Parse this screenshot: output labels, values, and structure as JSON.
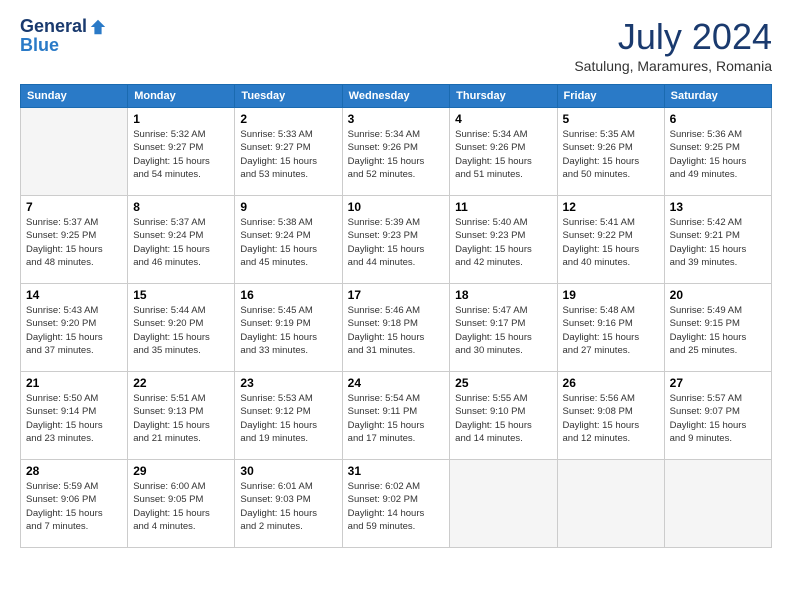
{
  "header": {
    "logo_general": "General",
    "logo_blue": "Blue",
    "month_year": "July 2024",
    "location": "Satulung, Maramures, Romania"
  },
  "days_of_week": [
    "Sunday",
    "Monday",
    "Tuesday",
    "Wednesday",
    "Thursday",
    "Friday",
    "Saturday"
  ],
  "weeks": [
    [
      {
        "day": "",
        "info": ""
      },
      {
        "day": "1",
        "info": "Sunrise: 5:32 AM\nSunset: 9:27 PM\nDaylight: 15 hours\nand 54 minutes."
      },
      {
        "day": "2",
        "info": "Sunrise: 5:33 AM\nSunset: 9:27 PM\nDaylight: 15 hours\nand 53 minutes."
      },
      {
        "day": "3",
        "info": "Sunrise: 5:34 AM\nSunset: 9:26 PM\nDaylight: 15 hours\nand 52 minutes."
      },
      {
        "day": "4",
        "info": "Sunrise: 5:34 AM\nSunset: 9:26 PM\nDaylight: 15 hours\nand 51 minutes."
      },
      {
        "day": "5",
        "info": "Sunrise: 5:35 AM\nSunset: 9:26 PM\nDaylight: 15 hours\nand 50 minutes."
      },
      {
        "day": "6",
        "info": "Sunrise: 5:36 AM\nSunset: 9:25 PM\nDaylight: 15 hours\nand 49 minutes."
      }
    ],
    [
      {
        "day": "7",
        "info": "Sunrise: 5:37 AM\nSunset: 9:25 PM\nDaylight: 15 hours\nand 48 minutes."
      },
      {
        "day": "8",
        "info": "Sunrise: 5:37 AM\nSunset: 9:24 PM\nDaylight: 15 hours\nand 46 minutes."
      },
      {
        "day": "9",
        "info": "Sunrise: 5:38 AM\nSunset: 9:24 PM\nDaylight: 15 hours\nand 45 minutes."
      },
      {
        "day": "10",
        "info": "Sunrise: 5:39 AM\nSunset: 9:23 PM\nDaylight: 15 hours\nand 44 minutes."
      },
      {
        "day": "11",
        "info": "Sunrise: 5:40 AM\nSunset: 9:23 PM\nDaylight: 15 hours\nand 42 minutes."
      },
      {
        "day": "12",
        "info": "Sunrise: 5:41 AM\nSunset: 9:22 PM\nDaylight: 15 hours\nand 40 minutes."
      },
      {
        "day": "13",
        "info": "Sunrise: 5:42 AM\nSunset: 9:21 PM\nDaylight: 15 hours\nand 39 minutes."
      }
    ],
    [
      {
        "day": "14",
        "info": "Sunrise: 5:43 AM\nSunset: 9:20 PM\nDaylight: 15 hours\nand 37 minutes."
      },
      {
        "day": "15",
        "info": "Sunrise: 5:44 AM\nSunset: 9:20 PM\nDaylight: 15 hours\nand 35 minutes."
      },
      {
        "day": "16",
        "info": "Sunrise: 5:45 AM\nSunset: 9:19 PM\nDaylight: 15 hours\nand 33 minutes."
      },
      {
        "day": "17",
        "info": "Sunrise: 5:46 AM\nSunset: 9:18 PM\nDaylight: 15 hours\nand 31 minutes."
      },
      {
        "day": "18",
        "info": "Sunrise: 5:47 AM\nSunset: 9:17 PM\nDaylight: 15 hours\nand 30 minutes."
      },
      {
        "day": "19",
        "info": "Sunrise: 5:48 AM\nSunset: 9:16 PM\nDaylight: 15 hours\nand 27 minutes."
      },
      {
        "day": "20",
        "info": "Sunrise: 5:49 AM\nSunset: 9:15 PM\nDaylight: 15 hours\nand 25 minutes."
      }
    ],
    [
      {
        "day": "21",
        "info": "Sunrise: 5:50 AM\nSunset: 9:14 PM\nDaylight: 15 hours\nand 23 minutes."
      },
      {
        "day": "22",
        "info": "Sunrise: 5:51 AM\nSunset: 9:13 PM\nDaylight: 15 hours\nand 21 minutes."
      },
      {
        "day": "23",
        "info": "Sunrise: 5:53 AM\nSunset: 9:12 PM\nDaylight: 15 hours\nand 19 minutes."
      },
      {
        "day": "24",
        "info": "Sunrise: 5:54 AM\nSunset: 9:11 PM\nDaylight: 15 hours\nand 17 minutes."
      },
      {
        "day": "25",
        "info": "Sunrise: 5:55 AM\nSunset: 9:10 PM\nDaylight: 15 hours\nand 14 minutes."
      },
      {
        "day": "26",
        "info": "Sunrise: 5:56 AM\nSunset: 9:08 PM\nDaylight: 15 hours\nand 12 minutes."
      },
      {
        "day": "27",
        "info": "Sunrise: 5:57 AM\nSunset: 9:07 PM\nDaylight: 15 hours\nand 9 minutes."
      }
    ],
    [
      {
        "day": "28",
        "info": "Sunrise: 5:59 AM\nSunset: 9:06 PM\nDaylight: 15 hours\nand 7 minutes."
      },
      {
        "day": "29",
        "info": "Sunrise: 6:00 AM\nSunset: 9:05 PM\nDaylight: 15 hours\nand 4 minutes."
      },
      {
        "day": "30",
        "info": "Sunrise: 6:01 AM\nSunset: 9:03 PM\nDaylight: 15 hours\nand 2 minutes."
      },
      {
        "day": "31",
        "info": "Sunrise: 6:02 AM\nSunset: 9:02 PM\nDaylight: 14 hours\nand 59 minutes."
      },
      {
        "day": "",
        "info": ""
      },
      {
        "day": "",
        "info": ""
      },
      {
        "day": "",
        "info": ""
      }
    ]
  ]
}
